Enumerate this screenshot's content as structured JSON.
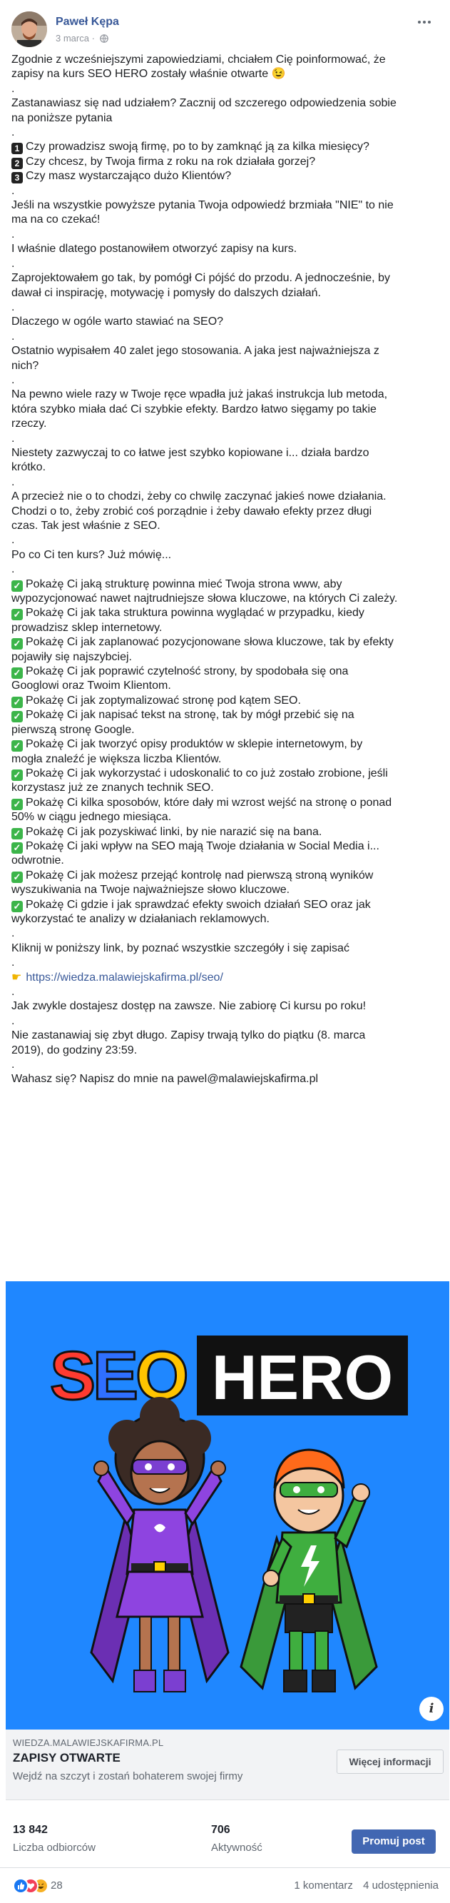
{
  "header": {
    "author": "Paweł Kępa",
    "date": "3 marca",
    "separator": "·"
  },
  "post": {
    "lines": [
      {
        "t": "Zgodnie z wcześniejszymi zapowiedziami, chciałem Cię poinformować, że"
      },
      {
        "t": "zapisy na kurs SEO HERO zostały właśnie otwarte 😉"
      },
      {
        "t": "."
      },
      {
        "t": "Zastanawiasz się nad udziałem? Zacznij od szczerego odpowiedzenia sobie"
      },
      {
        "t": "na poniższe pytania"
      },
      {
        "t": "."
      },
      {
        "t": "Czy prowadzisz swoją firmę, po to by zamknąć ją za kilka miesięcy?",
        "num": "1"
      },
      {
        "t": "Czy chcesz, by Twoja firma z roku na rok działała gorzej?",
        "num": "2"
      },
      {
        "t": "Czy masz wystarczająco dużo Klientów?",
        "num": "3"
      },
      {
        "t": "."
      },
      {
        "t": "Jeśli na wszystkie powyższe pytania Twoja odpowiedź brzmiała \"NIE\" to nie"
      },
      {
        "t": "ma na co czekać!"
      },
      {
        "t": "."
      },
      {
        "t": "I właśnie dlatego postanowiłem otworzyć zapisy na kurs."
      },
      {
        "t": "."
      },
      {
        "t": "Zaprojektowałem go tak, by pomógł Ci pójść do przodu. A jednocześnie, by"
      },
      {
        "t": "dawał ci inspirację, motywację i pomysły do dalszych działań."
      },
      {
        "t": "."
      },
      {
        "t": "Dlaczego w ogóle warto stawiać na SEO?"
      },
      {
        "t": "."
      },
      {
        "t": "Ostatnio wypisałem 40 zalet jego stosowania. A jaka jest najważniejsza z"
      },
      {
        "t": "nich?"
      },
      {
        "t": "."
      },
      {
        "t": "Na pewno wiele razy w Twoje ręce wpadła już jakaś instrukcja lub metoda,"
      },
      {
        "t": "która szybko miała dać Ci szybkie efekty. Bardzo łatwo sięgamy po takie"
      },
      {
        "t": "rzeczy."
      },
      {
        "t": "."
      },
      {
        "t": "Niestety zazwyczaj to co łatwe jest szybko kopiowane i... działa bardzo"
      },
      {
        "t": "krótko."
      },
      {
        "t": "."
      },
      {
        "t": "A przecież nie o to chodzi, żeby co chwilę zaczynać jakieś nowe działania."
      },
      {
        "t": "Chodzi o to, żeby zrobić coś porządnie i żeby dawało efekty przez długi"
      },
      {
        "t": "czas. Tak jest właśnie z SEO."
      },
      {
        "t": "."
      },
      {
        "t": "Po co Ci ten kurs? Już mówię..."
      },
      {
        "t": "."
      },
      {
        "t": "Pokażę Ci jaką strukturę powinna mieć Twoja strona www, aby",
        "check": true
      },
      {
        "t": "wypozycjonować nawet najtrudniejsze słowa kluczowe, na których Ci zależy."
      },
      {
        "t": "Pokażę Ci jak taka struktura powinna wyglądać w przypadku, kiedy",
        "check": true
      },
      {
        "t": "prowadzisz sklep internetowy."
      },
      {
        "t": "Pokażę Ci jak zaplanować pozycjonowane słowa kluczowe, tak by efekty",
        "check": true
      },
      {
        "t": "pojawiły się najszybciej."
      },
      {
        "t": "Pokażę Ci jak poprawić czytelność strony, by spodobała się ona",
        "check": true
      },
      {
        "t": "Googlowi oraz Twoim Klientom."
      },
      {
        "t": "Pokażę Ci jak zoptymalizować stronę pod kątem SEO.",
        "check": true
      },
      {
        "t": "Pokażę Ci jak napisać tekst na stronę, tak by mógł przebić się na",
        "check": true
      },
      {
        "t": "pierwszą stronę Google."
      },
      {
        "t": "Pokażę Ci jak tworzyć opisy produktów w sklepie internetowym, by",
        "check": true
      },
      {
        "t": "mogła znaleźć je większa liczba Klientów."
      },
      {
        "t": "Pokażę Ci jak wykorzystać i udoskonalić to co już zostało zrobione, jeśli",
        "check": true
      },
      {
        "t": "korzystasz już ze znanych technik SEO."
      },
      {
        "t": "Pokażę Ci kilka sposobów, które dały mi wzrost wejść na stronę o ponad",
        "check": true
      },
      {
        "t": "50% w ciągu jednego miesiąca."
      },
      {
        "t": "Pokażę Ci jak pozyskiwać linki, by nie narazić się na bana.",
        "check": true
      },
      {
        "t": "Pokażę Ci jaki wpływ na SEO mają Twoje działania w Social Media i...",
        "check": true
      },
      {
        "t": "odwrotnie."
      },
      {
        "t": "Pokażę Ci jak możesz przejąć kontrolę nad pierwszą stroną wyników",
        "check": true
      },
      {
        "t": "wyszukiwania na Twoje najważniejsze słowo kluczowe."
      },
      {
        "t": "Pokażę Ci gdzie i jak sprawdzać efekty swoich działań SEO oraz jak",
        "check": true
      },
      {
        "t": "wykorzystać te analizy w działaniach reklamowych."
      },
      {
        "t": "."
      },
      {
        "t": "Kliknij w poniższy link, by poznać wszystkie szczegóły i się zapisać"
      },
      {
        "t": "."
      },
      {
        "t": "https://wiedza.malawiejskafirma.pl/seo/",
        "point": true,
        "link": true
      },
      {
        "t": "."
      },
      {
        "t": "Jak zwykle dostajesz dostęp na zawsze. Nie zabiorę Ci kursu po roku!"
      },
      {
        "t": "."
      },
      {
        "t": "Nie zastanawiaj się zbyt długo. Zapisy trwają tylko do piątku (8. marca"
      },
      {
        "t": "2019), do godziny 23:59."
      },
      {
        "t": "."
      },
      {
        "t": "Wahasz się? Napisz do mnie na pawel@malawiejskafirma.pl"
      }
    ]
  },
  "image": {
    "logo_left": "SEO",
    "logo_right": "HERO",
    "info_label": "i"
  },
  "preview": {
    "domain": "WIEDZA.MALAWIEJSKAFIRMA.PL",
    "title": "ZAPISY OTWARTE",
    "subtitle": "Wejdź na szczyt i zostań bohaterem swojej firmy",
    "button": "Więcej informacji"
  },
  "stats": {
    "reach_value": "13 842",
    "reach_label": "Liczba odbiorców",
    "engagement_value": "706",
    "engagement_label": "Aktywność",
    "boost_button": "Promuj post"
  },
  "footer": {
    "reactions_count": "28",
    "comments": "1 komentarz",
    "shares": "4 udostępnienia"
  },
  "colors": {
    "accent": "#385898",
    "button_blue": "#4267b2",
    "image_bg": "#1f87ff",
    "check_green": "#3cb54a"
  },
  "icons": [
    "globe-icon",
    "more-icon",
    "info-icon",
    "like-reaction-icon",
    "love-reaction-icon",
    "haha-reaction-icon",
    "point-right-icon",
    "check-icon"
  ]
}
